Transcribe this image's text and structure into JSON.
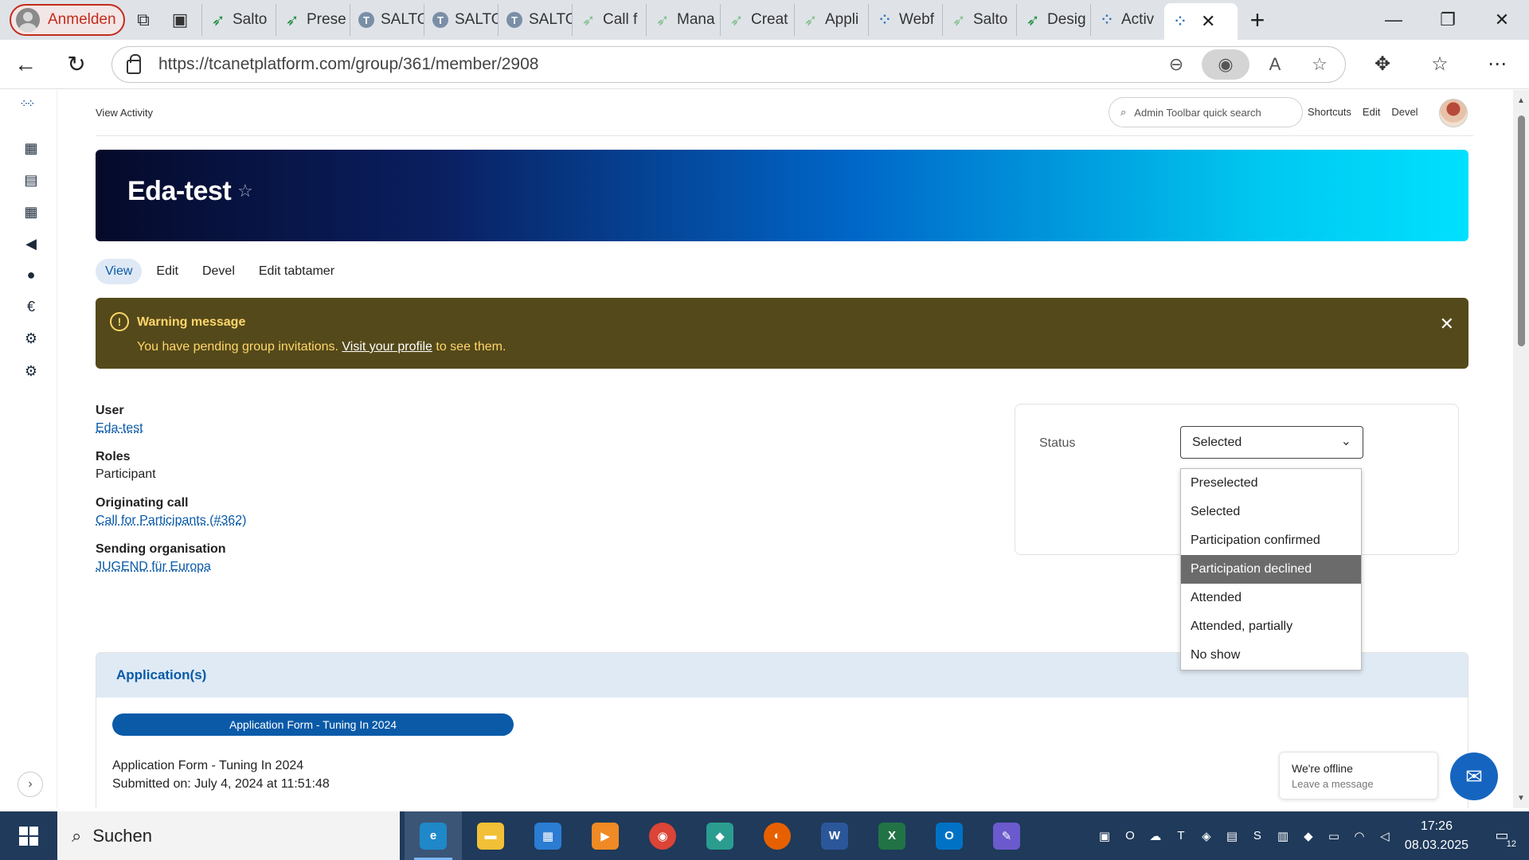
{
  "browser": {
    "profile_label": "Anmelden",
    "tabs": [
      {
        "label": "Salto",
        "icon": "green-leaf-icon"
      },
      {
        "label": "Prese",
        "icon": "green-leaf-icon"
      },
      {
        "label": "SALTO",
        "icon": "blue-person-icon"
      },
      {
        "label": "SALTO",
        "icon": "blue-person-icon"
      },
      {
        "label": "SALTO",
        "icon": "blue-person-icon"
      },
      {
        "label": "Call f",
        "icon": "light-leaf-icon"
      },
      {
        "label": "Mana",
        "icon": "light-leaf-icon"
      },
      {
        "label": "Creat",
        "icon": "light-leaf-icon"
      },
      {
        "label": "Appli",
        "icon": "light-leaf-icon"
      },
      {
        "label": "Webf",
        "icon": "dots-icon"
      },
      {
        "label": "Salto",
        "icon": "light-leaf-icon"
      },
      {
        "label": "Desig",
        "icon": "green-leaf-icon"
      },
      {
        "label": "Activ",
        "icon": "dots-icon"
      }
    ],
    "url": "https://tcanetplatform.com/group/361/member/2908"
  },
  "admin_toolbar": {
    "breadcrumb": "View Activity",
    "search_placeholder": "Admin Toolbar quick search",
    "links": [
      "Shortcuts",
      "Edit",
      "Devel"
    ]
  },
  "hero": {
    "title": "Eda-test"
  },
  "local_tabs": [
    "View",
    "Edit",
    "Devel",
    "Edit tabtamer"
  ],
  "warning": {
    "title": "Warning message",
    "body_prefix": "You have pending group invitations.",
    "link": "Visit your profile",
    "body_suffix": "to see them."
  },
  "fields": {
    "user_label": "User",
    "user_value": "Eda-test",
    "roles_label": "Roles",
    "roles_value": "Participant",
    "call_label": "Originating call",
    "call_value": "Call for Participants (#362)",
    "org_label": "Sending organisation",
    "org_value": "JUGEND für Europa"
  },
  "status": {
    "label": "Status",
    "selected": "Selected",
    "options": [
      "Preselected",
      "Selected",
      "Participation confirmed",
      "Participation declined",
      "Attended",
      "Attended, partially",
      "No show"
    ],
    "highlighted_index": 3
  },
  "applications": {
    "heading": "Application(s)",
    "pill": "Application Form - Tuning In 2024",
    "line1": "Application Form - Tuning In 2024",
    "line2": "Submitted on: July 4, 2024 at 11:51:48"
  },
  "chat": {
    "title": "We're offline",
    "subtitle": "Leave a message"
  },
  "taskbar": {
    "search_label": "Suchen",
    "time": "17:26",
    "date": "08.03.2025",
    "notification_count": "12"
  }
}
